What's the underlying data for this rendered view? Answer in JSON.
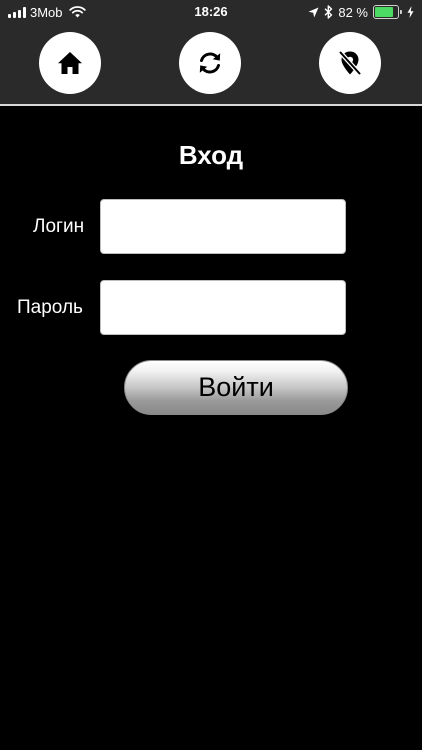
{
  "status_bar": {
    "carrier": "3Mob",
    "time": "18:26",
    "battery_percent_text": "82 %",
    "battery_level": 0.82,
    "battery_color": "#4cd964",
    "icons": [
      "signal-bars-icon",
      "wifi-icon",
      "location-arrow-icon",
      "bluetooth-icon",
      "battery-icon",
      "charging-bolt-icon"
    ]
  },
  "toolbar": {
    "buttons": [
      {
        "name": "home-button",
        "icon": "home-icon"
      },
      {
        "name": "refresh-button",
        "icon": "refresh-icon"
      },
      {
        "name": "location-off-button",
        "icon": "location-off-icon"
      }
    ]
  },
  "login": {
    "title": "Вход",
    "login_label": "Логин",
    "login_value": "",
    "password_label": "Пароль",
    "password_value": "",
    "submit_label": "Войти"
  },
  "colors": {
    "background": "#000000",
    "toolbar": "#2a2a2a",
    "text": "#ffffff"
  }
}
